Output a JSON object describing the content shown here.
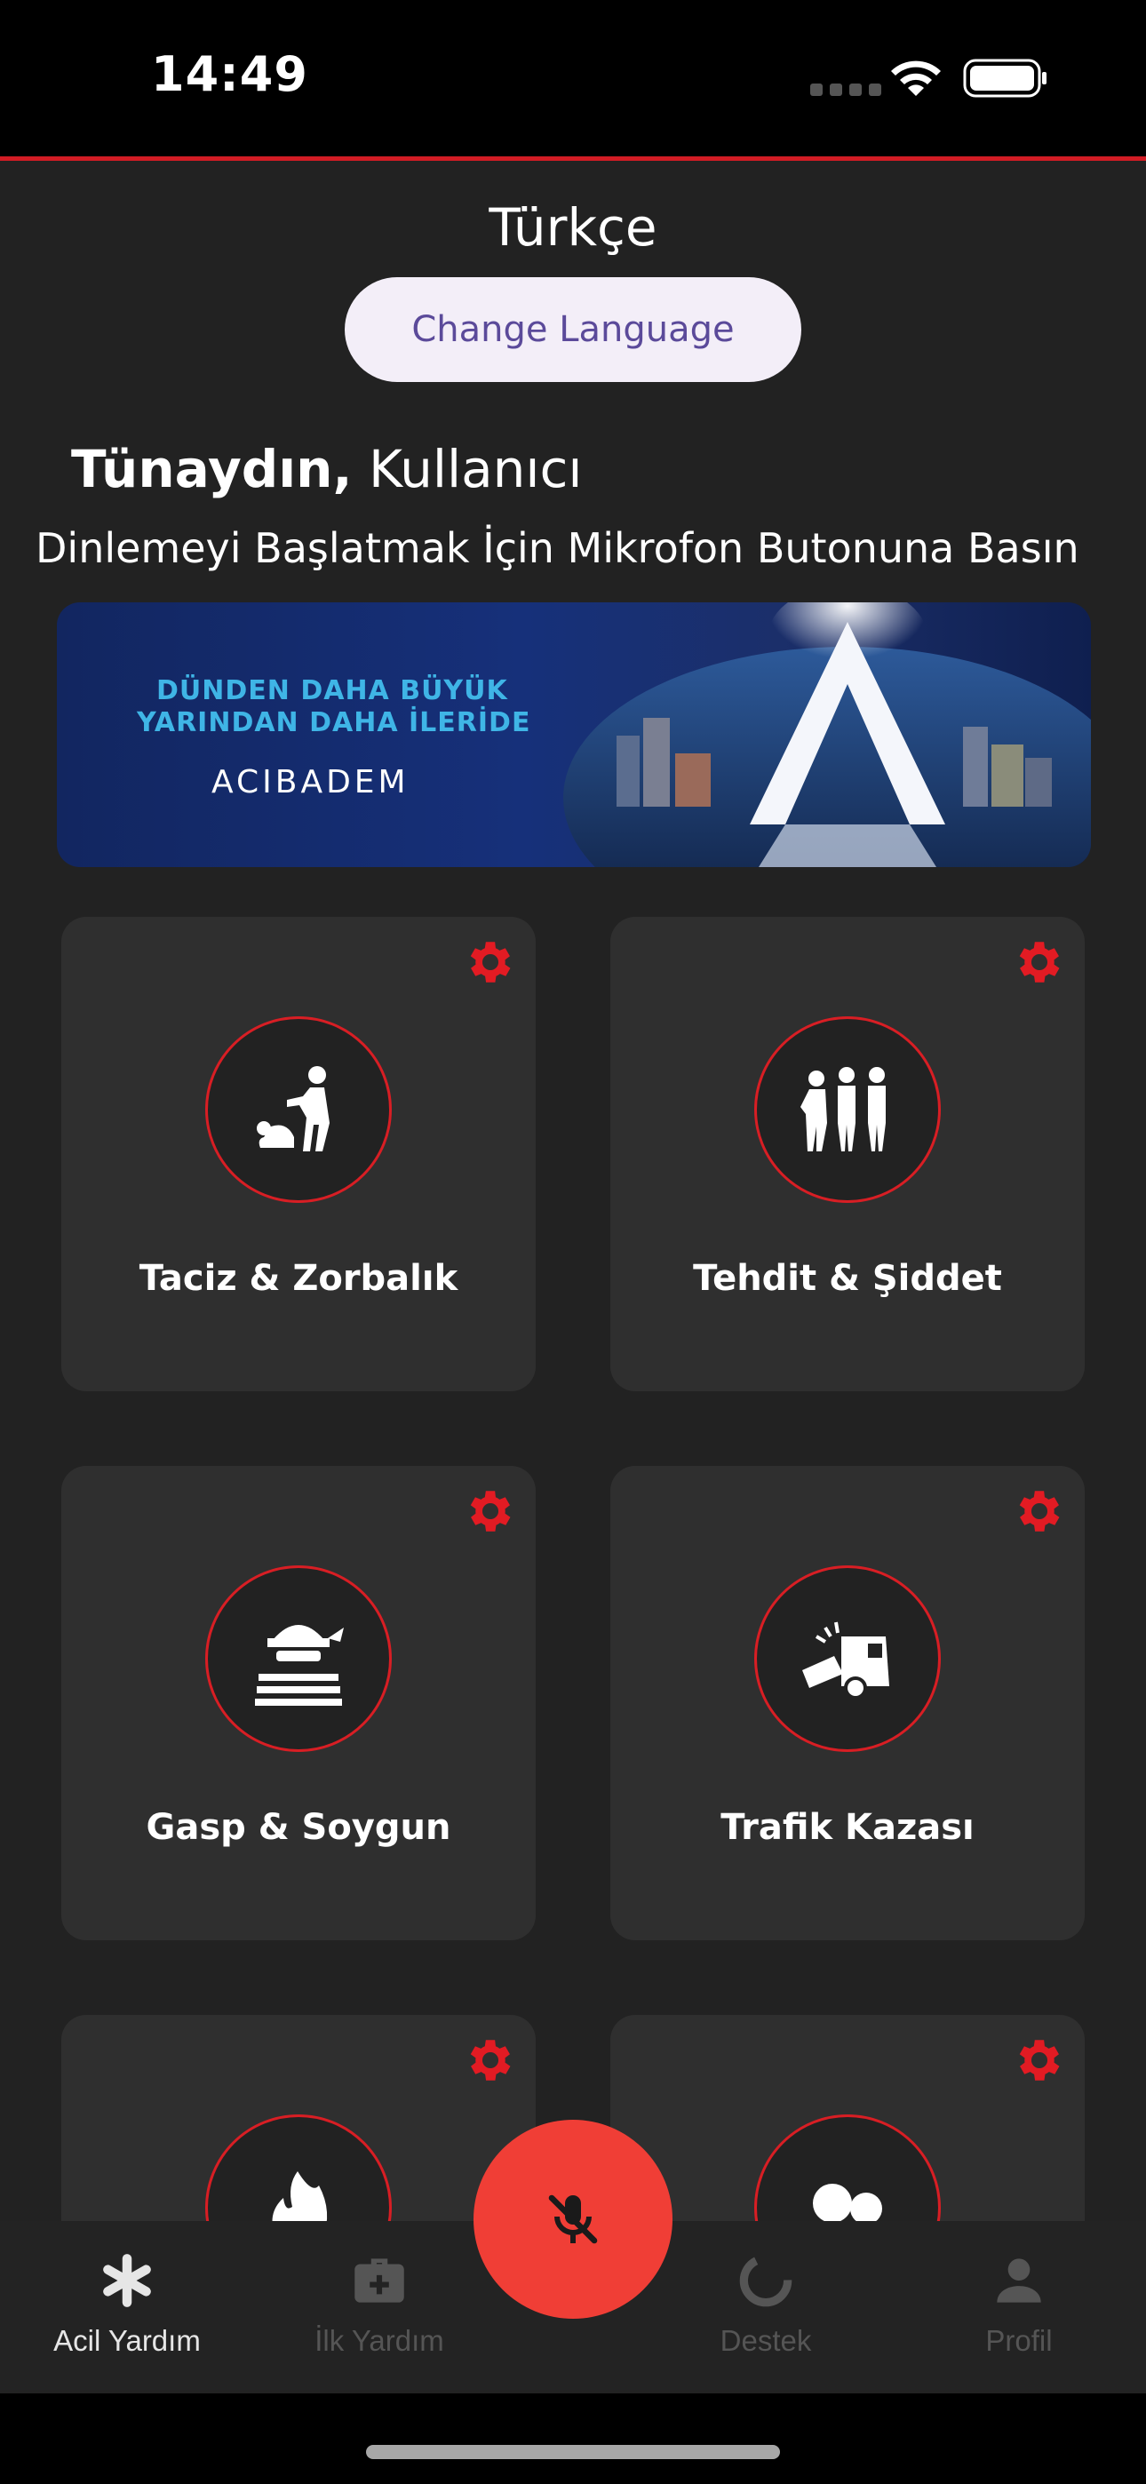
{
  "status_bar": {
    "time": "14:49"
  },
  "language": {
    "current": "Türkçe",
    "change_button": "Change Language"
  },
  "greeting": {
    "salutation": "Tünaydın,",
    "user": "Kullanıcı"
  },
  "instruction": "Dinlemeyi Başlatmak İçin Mikrofon Butonuna Basın",
  "banner": {
    "line1": "DÜNDEN DAHA BÜYÜK",
    "line2": "YARINDAN DAHA İLERİDE",
    "brand": "ACIBADEM"
  },
  "cards": [
    {
      "label": "Taciz & Zorbalık",
      "icon": "harassment-icon"
    },
    {
      "label": "Tehdit & Şiddet",
      "icon": "violence-icon"
    },
    {
      "label": "Gasp & Soygun",
      "icon": "robber-icon"
    },
    {
      "label": "Trafik Kazası",
      "icon": "traffic-accident-icon"
    },
    {
      "label": "",
      "icon": "fire-icon"
    },
    {
      "label": "",
      "icon": "dots-icon"
    }
  ],
  "nav": [
    {
      "label": "Acil Yardım",
      "icon": "asterisk-icon",
      "active": true
    },
    {
      "label": "İlk Yardım",
      "icon": "first-aid-kit-icon",
      "active": false
    },
    {
      "label": "Destek",
      "icon": "support-ring-icon",
      "active": false
    },
    {
      "label": "Profil",
      "icon": "person-icon",
      "active": false
    }
  ],
  "mic_button": {
    "icon": "mic-off-icon"
  },
  "colors": {
    "accent_red": "#d81e24",
    "fab_red": "#f03e36",
    "background": "#222222",
    "card": "#2f2f2f",
    "button_text": "#5b4a9a"
  }
}
